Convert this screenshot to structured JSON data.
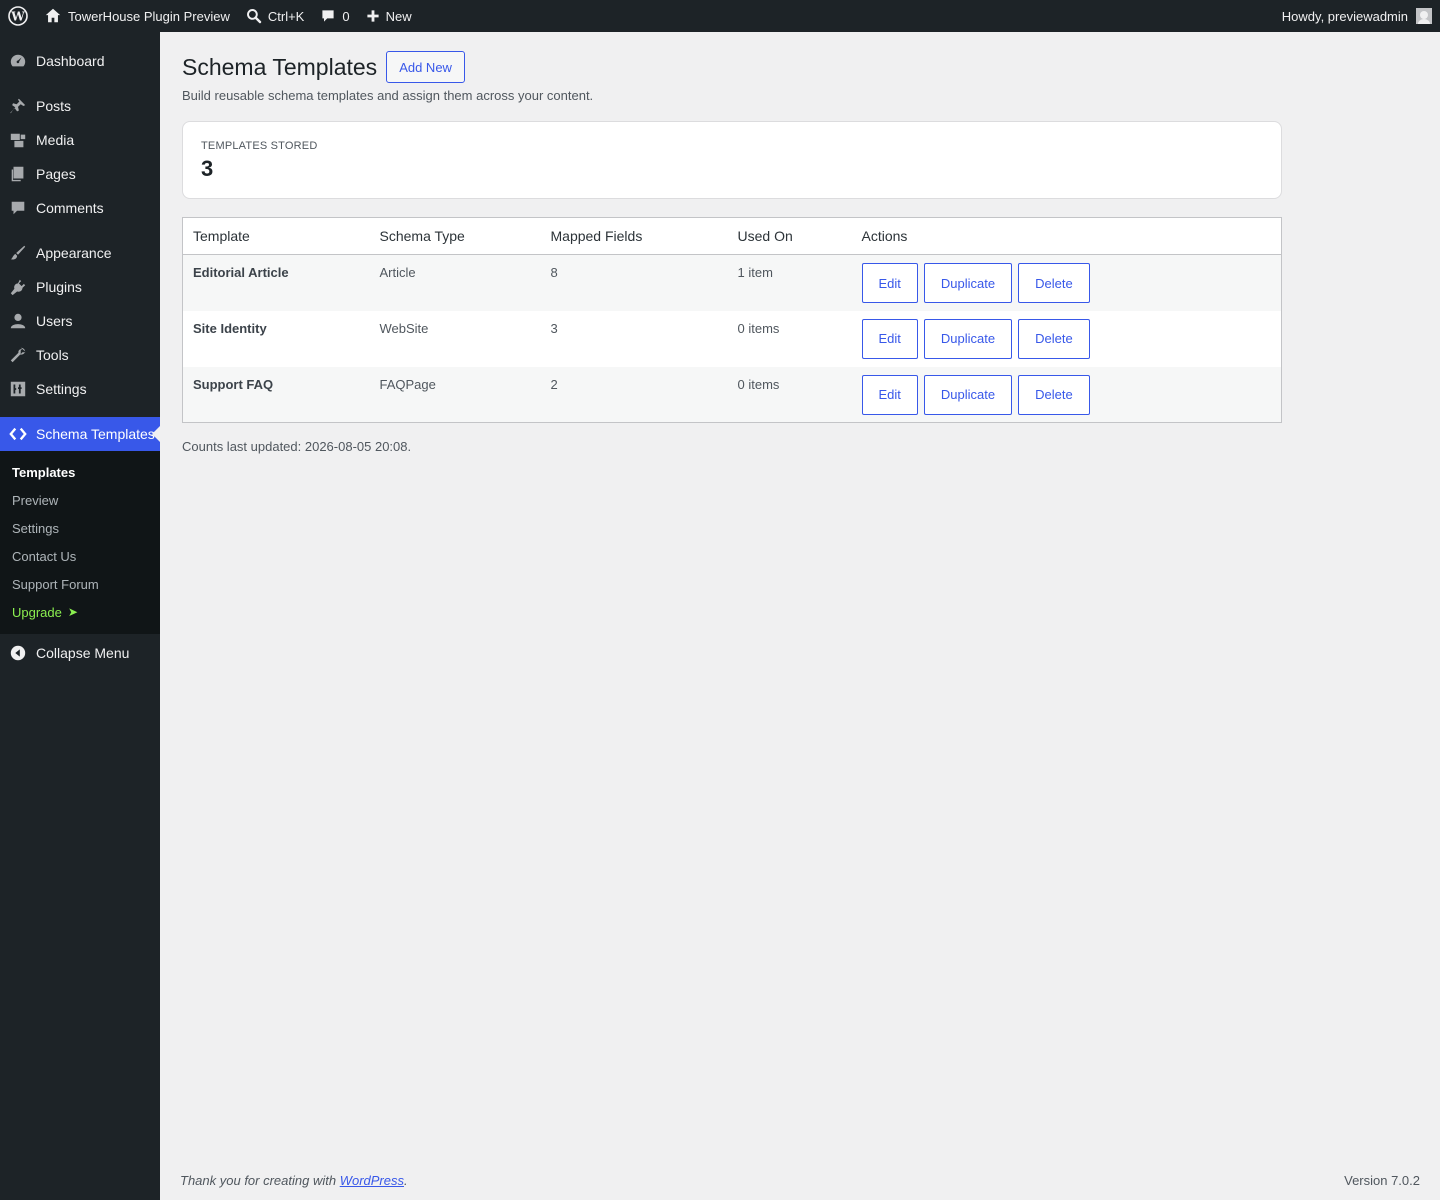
{
  "adminbar": {
    "site_name": "TowerHouse Plugin Preview",
    "search_shortcut": "Ctrl+K",
    "comments_count": "0",
    "new_label": "New",
    "howdy": "Howdy, previewadmin"
  },
  "sidebar": {
    "items": [
      {
        "label": "Dashboard"
      },
      {
        "label": "Posts"
      },
      {
        "label": "Media"
      },
      {
        "label": "Pages"
      },
      {
        "label": "Comments"
      },
      {
        "label": "Appearance"
      },
      {
        "label": "Plugins"
      },
      {
        "label": "Users"
      },
      {
        "label": "Tools"
      },
      {
        "label": "Settings"
      },
      {
        "label": "Schema Templates"
      }
    ],
    "submenu": [
      {
        "label": "Templates"
      },
      {
        "label": "Preview"
      },
      {
        "label": "Settings"
      },
      {
        "label": "Contact Us"
      },
      {
        "label": "Support Forum"
      },
      {
        "label": "Upgrade"
      }
    ],
    "collapse_label": "Collapse Menu"
  },
  "page": {
    "title": "Schema Templates",
    "add_new_label": "Add New",
    "subtitle": "Build reusable schema templates and assign them across your content."
  },
  "stat": {
    "label": "Templates Stored",
    "value": "3"
  },
  "table": {
    "headers": [
      "Template",
      "Schema Type",
      "Mapped Fields",
      "Used On",
      "Actions"
    ],
    "rows": [
      {
        "name": "Editorial Article",
        "type": "Article",
        "fields": "8",
        "used": "1 item"
      },
      {
        "name": "Site Identity",
        "type": "WebSite",
        "fields": "3",
        "used": "0 items"
      },
      {
        "name": "Support FAQ",
        "type": "FAQPage",
        "fields": "2",
        "used": "0 items"
      }
    ],
    "actions": {
      "edit": "Edit",
      "duplicate": "Duplicate",
      "delete": "Delete"
    }
  },
  "counts_note": "Counts last updated: 2026-08-05 20:08.",
  "footer": {
    "thanks_prefix": "Thank you for creating with ",
    "thanks_link": "WordPress",
    "thanks_suffix": ".",
    "version": "Version 7.0.2"
  },
  "colors": {
    "accent": "#3858e9",
    "adminbar_bg": "#1d2327",
    "upgrade": "#8bf050"
  }
}
